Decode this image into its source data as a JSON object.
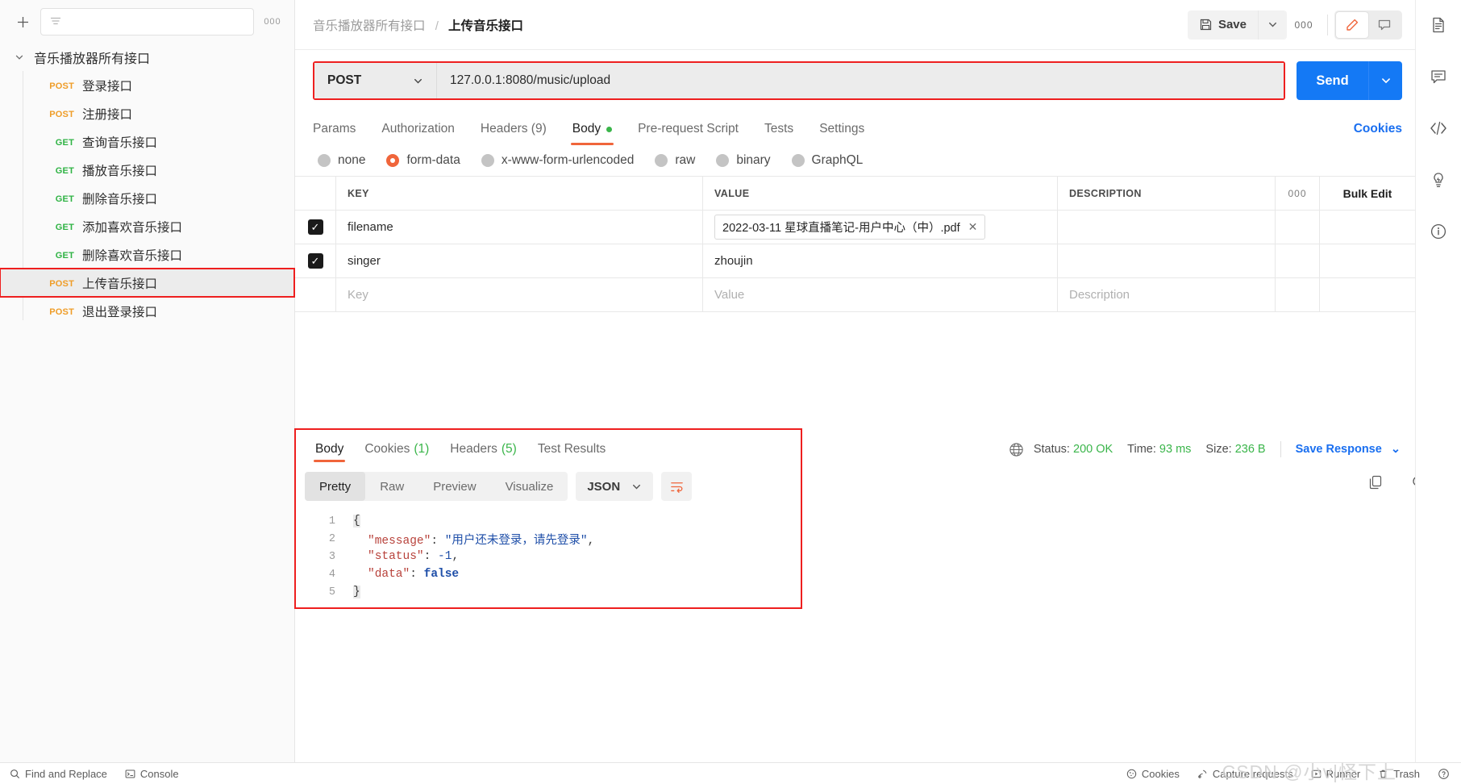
{
  "sidebar": {
    "plus_label": "+",
    "filter_placeholder": "",
    "more_label": "000",
    "collection": {
      "name": "音乐播放器所有接口",
      "expanded": true
    },
    "requests": [
      {
        "method": "POST",
        "name": "登录接口"
      },
      {
        "method": "POST",
        "name": "注册接口"
      },
      {
        "method": "GET",
        "name": "查询音乐接口"
      },
      {
        "method": "GET",
        "name": "播放音乐接口"
      },
      {
        "method": "GET",
        "name": "删除音乐接口"
      },
      {
        "method": "GET",
        "name": "添加喜欢音乐接口"
      },
      {
        "method": "GET",
        "name": "删除喜欢音乐接口"
      },
      {
        "method": "POST",
        "name": "上传音乐接口",
        "selected": true,
        "highlighted": true
      },
      {
        "method": "POST",
        "name": "退出登录接口"
      }
    ]
  },
  "topbar": {
    "breadcrumb_parent": "音乐播放器所有接口",
    "breadcrumb_sep": "/",
    "breadcrumb_current": "上传音乐接口",
    "save_label": "Save",
    "more_label": "000"
  },
  "url_bar": {
    "method": "POST",
    "url": "127.0.0.1:8080/music/upload",
    "send_label": "Send",
    "highlight_color": "#ee1f1f"
  },
  "request_tabs": {
    "items": [
      {
        "label": "Params",
        "active": false
      },
      {
        "label": "Authorization",
        "active": false
      },
      {
        "label": "Headers (9)",
        "active": false
      },
      {
        "label": "Body",
        "active": true,
        "dot": true
      },
      {
        "label": "Pre-request Script",
        "active": false
      },
      {
        "label": "Tests",
        "active": false
      },
      {
        "label": "Settings",
        "active": false
      }
    ],
    "cookies_link": "Cookies"
  },
  "body_types": [
    {
      "label": "none",
      "selected": false
    },
    {
      "label": "form-data",
      "selected": true
    },
    {
      "label": "x-www-form-urlencoded",
      "selected": false
    },
    {
      "label": "raw",
      "selected": false
    },
    {
      "label": "binary",
      "selected": false
    },
    {
      "label": "GraphQL",
      "selected": false
    }
  ],
  "form_table": {
    "headers": {
      "key": "KEY",
      "value": "VALUE",
      "description": "DESCRIPTION"
    },
    "more_label": "000",
    "bulk_edit_label": "Bulk Edit",
    "rows": [
      {
        "checked": true,
        "key": "filename",
        "value": "2022-03-11 星球直播笔记-用户中心（中）.pdf",
        "value_is_file": true,
        "remove_label": "✕",
        "description": ""
      },
      {
        "checked": true,
        "key": "singer",
        "value": "zhoujin",
        "value_is_file": false,
        "description": ""
      }
    ],
    "placeholder_row": {
      "key": "Key",
      "value": "Value",
      "description": "Description"
    }
  },
  "response": {
    "tabs": [
      {
        "label": "Body",
        "count": "",
        "active": true
      },
      {
        "label": "Cookies",
        "count": "(1)",
        "active": false
      },
      {
        "label": "Headers",
        "count": "(5)",
        "active": false
      },
      {
        "label": "Test Results",
        "count": "",
        "active": false
      }
    ],
    "status_label": "Status:",
    "status_value": "200 OK",
    "time_label": "Time:",
    "time_value": "93 ms",
    "size_label": "Size:",
    "size_value": "236 B",
    "save_response_label": "Save Response",
    "view_modes": [
      {
        "label": "Pretty",
        "active": true
      },
      {
        "label": "Raw",
        "active": false
      },
      {
        "label": "Preview",
        "active": false
      },
      {
        "label": "Visualize",
        "active": false
      }
    ],
    "format": "JSON",
    "code_lines": [
      {
        "n": "1",
        "html": "brace_open"
      },
      {
        "n": "2",
        "key": "\"message\"",
        "colon": ": ",
        "val": "\"用户还未登录，请先登录\"",
        "val_type": "str",
        "trail": ","
      },
      {
        "n": "3",
        "key": "\"status\"",
        "colon": ": ",
        "val": "-1",
        "val_type": "num",
        "trail": ","
      },
      {
        "n": "4",
        "key": "\"data\"",
        "colon": ": ",
        "val": "false",
        "val_type": "bool",
        "trail": ""
      },
      {
        "n": "5",
        "html": "brace_close"
      }
    ],
    "raw_json": {
      "message": "用户还未登录，请先登录",
      "status": -1,
      "data": false
    }
  },
  "status_bar": {
    "find_replace": "Find and Replace",
    "console": "Console",
    "cookies": "Cookies",
    "capture": "Capture requests",
    "runner": "Runner",
    "trash": "Trash",
    "watermark": "CSDN @小v|怪下上"
  }
}
